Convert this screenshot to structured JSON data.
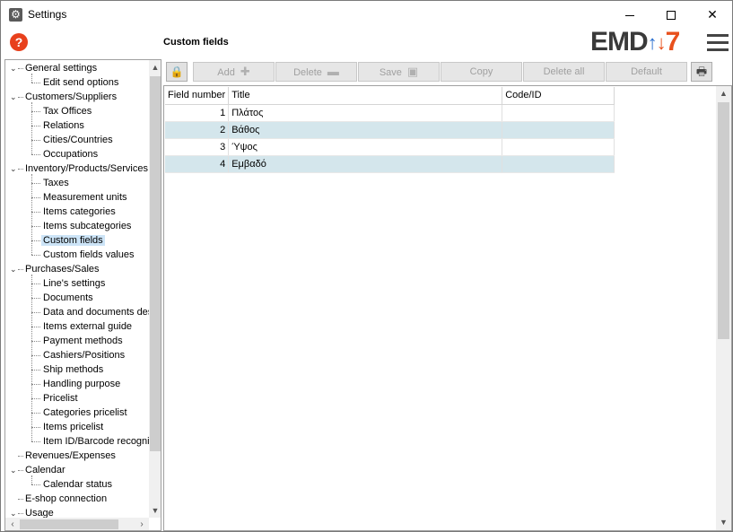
{
  "window": {
    "title": "Settings"
  },
  "header": {
    "page_title": "Custom fields",
    "logo_left": "EMD",
    "logo_right": "7"
  },
  "tree": [
    {
      "label": "General settings",
      "level": 0,
      "expanded": true
    },
    {
      "label": "Edit send options",
      "level": 1
    },
    {
      "label": "Customers/Suppliers",
      "level": 0,
      "expanded": true
    },
    {
      "label": "Tax Offices",
      "level": 1
    },
    {
      "label": "Relations",
      "level": 1
    },
    {
      "label": "Cities/Countries",
      "level": 1
    },
    {
      "label": "Occupations",
      "level": 1
    },
    {
      "label": "Inventory/Products/Services",
      "level": 0,
      "expanded": true
    },
    {
      "label": "Taxes",
      "level": 1
    },
    {
      "label": "Measurement units",
      "level": 1
    },
    {
      "label": "Items categories",
      "level": 1
    },
    {
      "label": "Items subcategories",
      "level": 1
    },
    {
      "label": "Custom fields",
      "level": 1,
      "selected": true
    },
    {
      "label": "Custom fields values",
      "level": 1
    },
    {
      "label": "Purchases/Sales",
      "level": 0,
      "expanded": true
    },
    {
      "label": "Line's settings",
      "level": 1
    },
    {
      "label": "Documents",
      "level": 1
    },
    {
      "label": "Data and documents des",
      "level": 1
    },
    {
      "label": "Items external guide",
      "level": 1
    },
    {
      "label": "Payment methods",
      "level": 1
    },
    {
      "label": "Cashiers/Positions",
      "level": 1
    },
    {
      "label": "Ship methods",
      "level": 1
    },
    {
      "label": "Handling purpose",
      "level": 1
    },
    {
      "label": "Pricelist",
      "level": 1
    },
    {
      "label": "Categories pricelist",
      "level": 1
    },
    {
      "label": "Items pricelist",
      "level": 1
    },
    {
      "label": "Item ID/Barcode recogni",
      "level": 1
    },
    {
      "label": "Revenues/Expenses",
      "level": 0
    },
    {
      "label": "Calendar",
      "level": 0,
      "expanded": true
    },
    {
      "label": "Calendar status",
      "level": 1
    },
    {
      "label": "E-shop connection",
      "level": 0
    },
    {
      "label": "Usage",
      "level": 0,
      "expanded": true
    }
  ],
  "toolbar": {
    "add": "Add",
    "delete": "Delete",
    "save": "Save",
    "copy": "Copy",
    "delete_all": "Delete all",
    "default": "Default"
  },
  "grid": {
    "columns": [
      "Field number",
      "Title",
      "Code/ID"
    ],
    "rows": [
      {
        "num": "1",
        "title": "Πλάτος",
        "code": ""
      },
      {
        "num": "2",
        "title": "Βάθος",
        "code": ""
      },
      {
        "num": "3",
        "title": "Ύψος",
        "code": ""
      },
      {
        "num": "4",
        "title": "Εμβαδό",
        "code": ""
      }
    ]
  },
  "icons": {
    "app": "gear-icon",
    "help": "help-icon",
    "lock": "lock-icon",
    "print": "printer-icon",
    "add": "plus-icon",
    "delete": "minus-icon",
    "save": "floppy-icon",
    "menu": "hamburger-icon"
  },
  "colors": {
    "accent_orange": "#e8501c",
    "accent_blue": "#2a6fd0",
    "row_alt": "#d4e6ec",
    "selection": "#cce4f7"
  }
}
